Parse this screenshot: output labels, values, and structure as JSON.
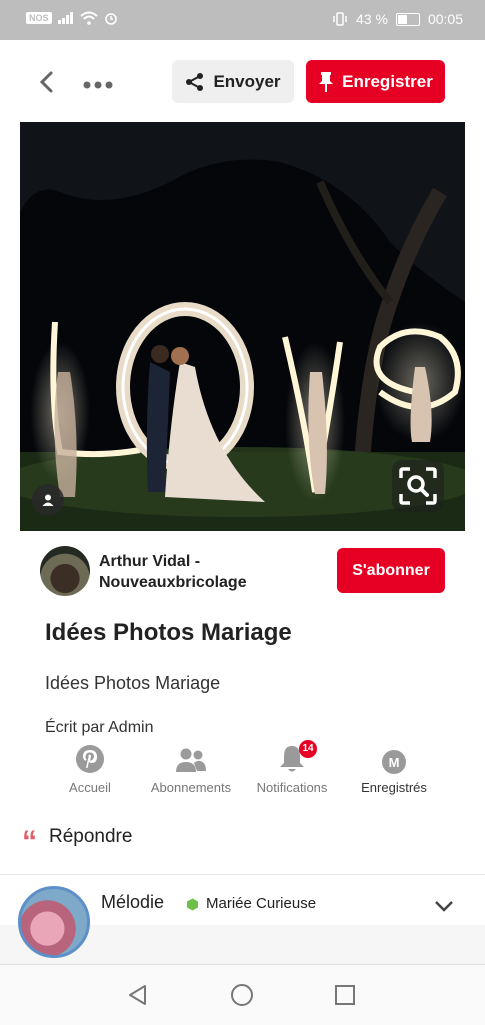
{
  "status_bar": {
    "left_chip": "NOS",
    "battery_percent_text": "43 %",
    "battery_level": 0.43,
    "time": "00:05"
  },
  "toolbar": {
    "send_label": "Envoyer",
    "save_label": "Enregistrer"
  },
  "pin": {
    "author_name": "Arthur Vidal - Nouveauxbricolage",
    "follow_label": "S'abonner",
    "title": "Idées Photos Mariage",
    "description": "Idées Photos Mariage",
    "written_by": "Écrit par Admin"
  },
  "bottom_nav": {
    "items": [
      {
        "label": "Accueil",
        "icon": "pinterest-icon"
      },
      {
        "label": "Abonnements",
        "icon": "people-icon"
      },
      {
        "label": "Notifications",
        "icon": "bell-icon",
        "badge": "14"
      },
      {
        "label": "Enregistrés",
        "icon": "profile-m-icon",
        "initial": "M"
      }
    ]
  },
  "reply": {
    "label": "Répondre"
  },
  "comment": {
    "author": "Mélodie",
    "status": "Mariée Curieuse"
  },
  "colors": {
    "brand_red": "#e60023",
    "status_green": "#6cc04a"
  }
}
